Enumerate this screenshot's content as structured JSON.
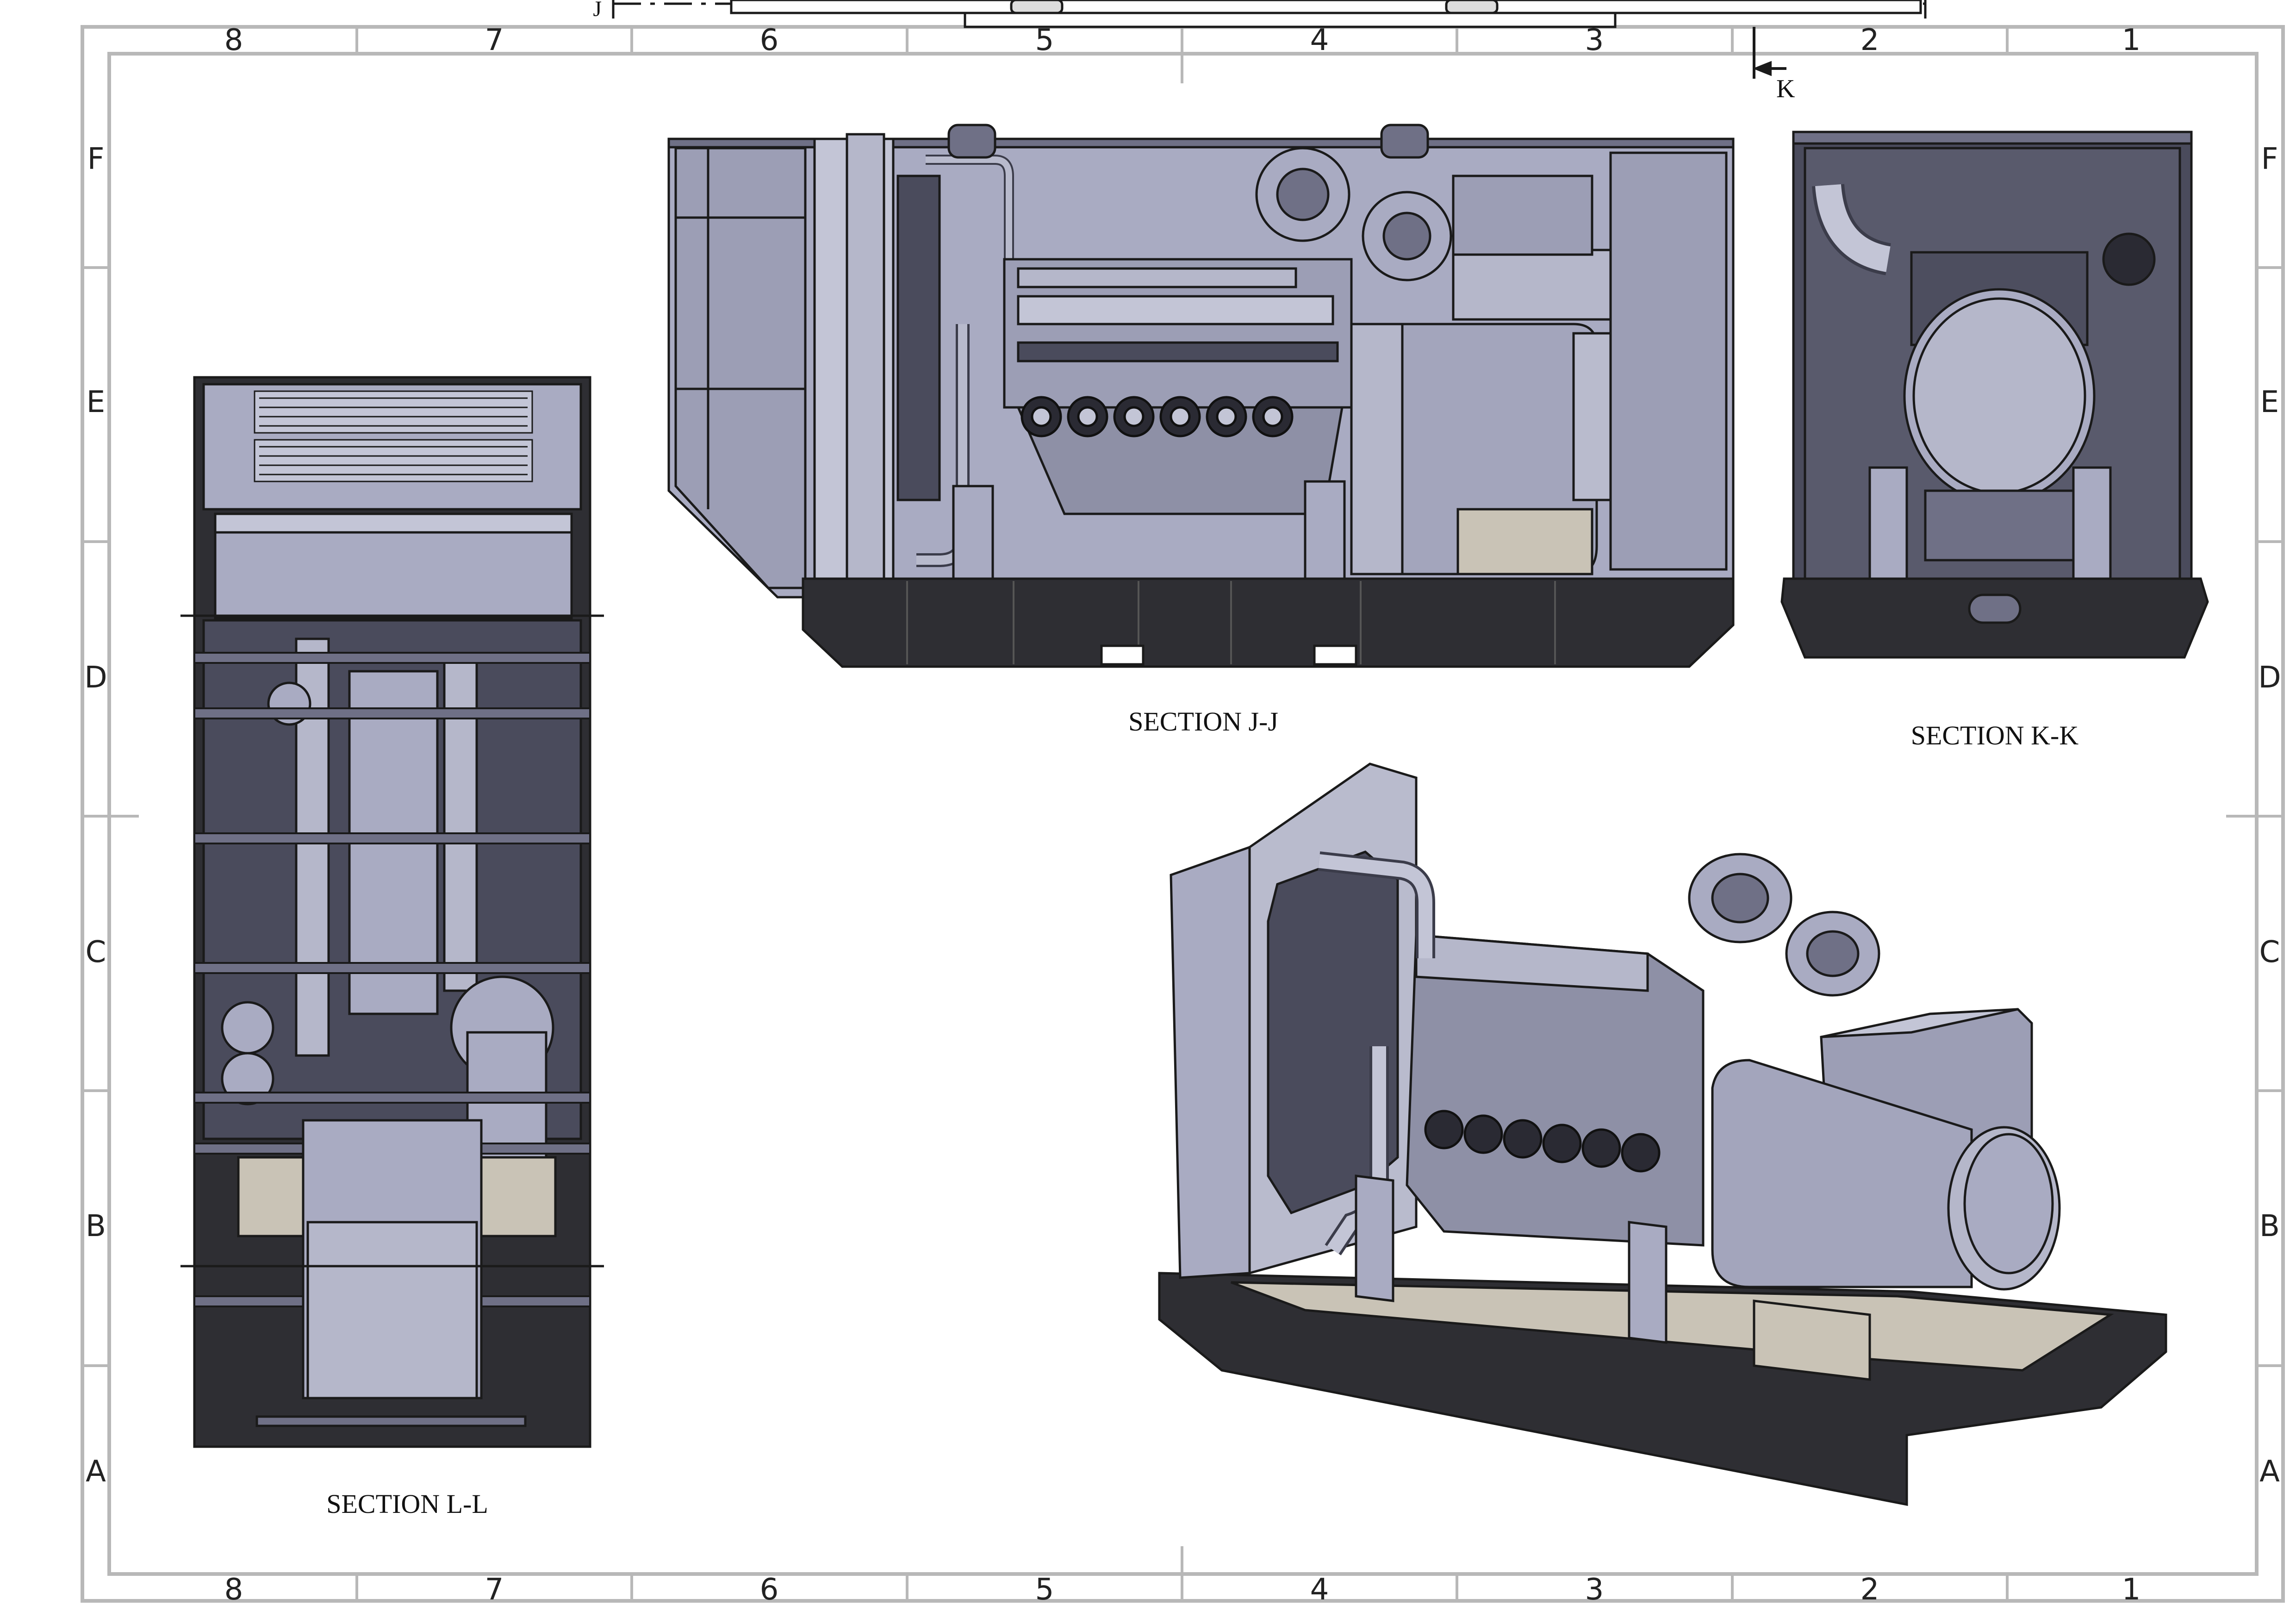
{
  "sheet": {
    "columns": [
      "8",
      "7",
      "6",
      "5",
      "4",
      "3",
      "2",
      "1"
    ],
    "rows": [
      "F",
      "E",
      "D",
      "C",
      "B",
      "A"
    ]
  },
  "views": {
    "section_jj": "SECTION J-J",
    "section_kk": "SECTION K-K",
    "section_ll": "SECTION L-L",
    "isometric": ""
  },
  "markers": {
    "k_arrow": "K",
    "j_arrow": "J"
  },
  "colors": {
    "frame": "#b8b8b8",
    "metal": "#a9abc2",
    "metal_light": "#c3c5d6",
    "metal_dark": "#6f7086",
    "base": "#2e2e33",
    "floor": "#c9c3b6",
    "line": "#1a1a1a"
  }
}
